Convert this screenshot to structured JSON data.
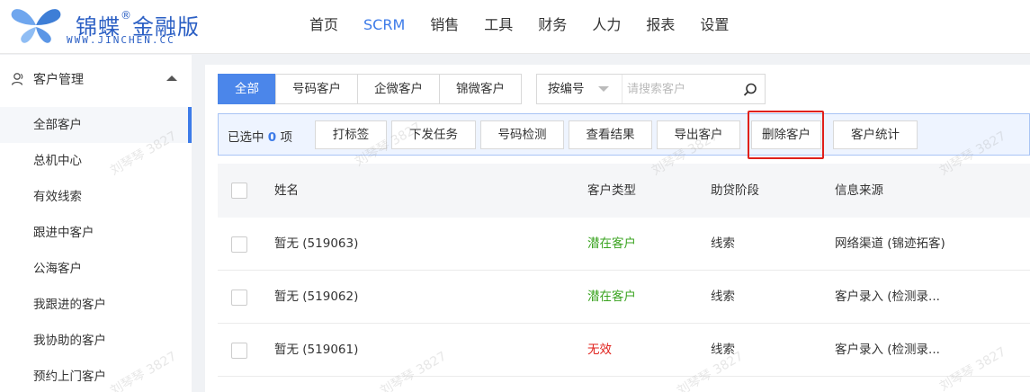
{
  "logo": {
    "brand": "锦蝶",
    "reg_mark": "®",
    "edition": "金融版",
    "url": "WWW.JINCHEN.CC"
  },
  "nav": {
    "items": [
      {
        "label": "首页"
      },
      {
        "label": "SCRM"
      },
      {
        "label": "销售"
      },
      {
        "label": "工具"
      },
      {
        "label": "财务"
      },
      {
        "label": "人力"
      },
      {
        "label": "报表"
      },
      {
        "label": "设置"
      }
    ],
    "active": "SCRM"
  },
  "sidebar": {
    "group": {
      "label": "客户管理",
      "icon": "user-icon"
    },
    "items": [
      {
        "label": "全部客户"
      },
      {
        "label": "总机中心"
      },
      {
        "label": "有效线索"
      },
      {
        "label": "跟进中客户"
      },
      {
        "label": "公海客户"
      },
      {
        "label": "我跟进的客户"
      },
      {
        "label": "我协助的客户"
      },
      {
        "label": "预约上门客户"
      }
    ],
    "active": "全部客户"
  },
  "tabs": [
    {
      "label": "全部"
    },
    {
      "label": "号码客户"
    },
    {
      "label": "企微客户"
    },
    {
      "label": "锦微客户"
    }
  ],
  "search": {
    "select_value": "按编号",
    "placeholder": "请搜索客户"
  },
  "toolbar": {
    "selected_prefix": "已选中",
    "selected_count": "0",
    "selected_suffix": "项",
    "buttons": [
      {
        "label": "打标签"
      },
      {
        "label": "下发任务"
      },
      {
        "label": "号码检测"
      },
      {
        "label": "查看结果"
      },
      {
        "label": "导出客户"
      },
      {
        "label": "删除客户"
      },
      {
        "label": "客户统计"
      }
    ]
  },
  "table": {
    "columns": [
      "姓名",
      "客户类型",
      "助贷阶段",
      "信息来源"
    ],
    "rows": [
      {
        "name": "暂无 (519063)",
        "type": "潜在客户",
        "stage": "线索",
        "source": "网络渠道 (锦迹拓客)"
      },
      {
        "name": "暂无 (519062)",
        "type": "潜在客户",
        "stage": "线索",
        "source": "客户录入 (检测录..."
      },
      {
        "name": "暂无 (519061)",
        "type": "无效",
        "stage": "线索",
        "source": "客户录入 (检测录..."
      }
    ]
  },
  "colors": {
    "accent": "#3d7be8",
    "potential": "#3aa320",
    "invalid": "#e0201b",
    "highlight": "#e0201b"
  },
  "watermark": "刘琴琴 3827"
}
